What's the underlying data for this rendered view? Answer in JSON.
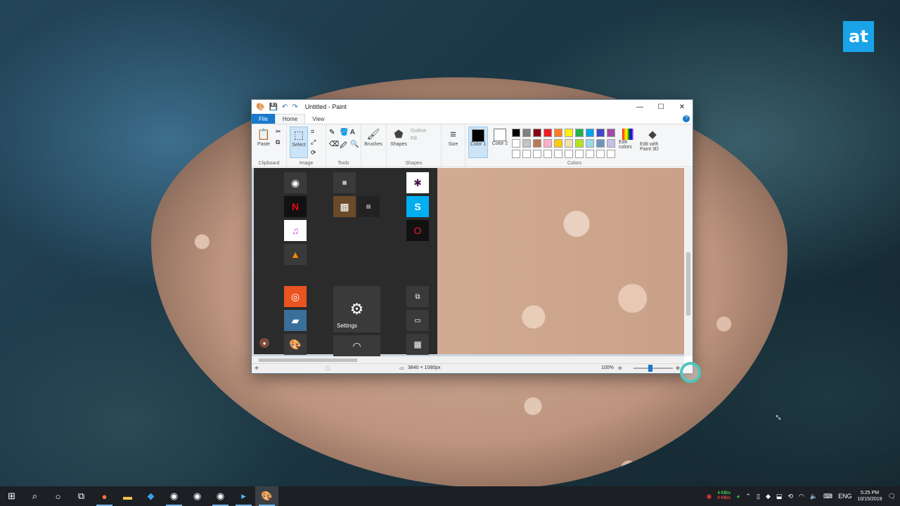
{
  "brand": {
    "logo_text": "at",
    "color": "#1aa3e8"
  },
  "window": {
    "title": "Untitled - Paint",
    "controls": {
      "minimize": "—",
      "maximize": "☐",
      "close": "✕"
    }
  },
  "tabs": [
    {
      "label": "File"
    },
    {
      "label": "Home"
    },
    {
      "label": "View"
    }
  ],
  "ribbon": {
    "clipboard": {
      "paste": "Paste",
      "group": "Clipboard"
    },
    "image": {
      "select": "Select",
      "group": "Image"
    },
    "tools": {
      "group": "Tools"
    },
    "brushes": {
      "label": "Brushes"
    },
    "shapes": {
      "label": "Shapes",
      "outline": "Outline",
      "fill": "Fill",
      "group": "Shapes"
    },
    "size": {
      "label": "Size"
    },
    "colors": {
      "color1": "Color 1",
      "color2": "Color 2",
      "edit_colors": "Edit colors",
      "edit_paint3d": "Edit with Paint 3D",
      "group": "Colors",
      "palette": [
        "#000000",
        "#7f7f7f",
        "#880015",
        "#ed1c24",
        "#ff7f27",
        "#fff200",
        "#22b14c",
        "#00a2e8",
        "#3f48cc",
        "#a349a4",
        "#ffffff",
        "#c3c3c3",
        "#b97a57",
        "#ffaec9",
        "#ffc90e",
        "#efe4b0",
        "#b5e61d",
        "#99d9ea",
        "#7092be",
        "#c8bfe7",
        "#ffffff",
        "#ffffff",
        "#ffffff",
        "#ffffff",
        "#ffffff",
        "#ffffff",
        "#ffffff",
        "#ffffff",
        "#ffffff",
        "#ffffff"
      ]
    }
  },
  "canvas": {
    "settings_tile_label": "Settings"
  },
  "statusbar": {
    "dimensions": "3840 × 1080px",
    "zoom": "100%"
  },
  "tray": {
    "net_up": "4 KB/s",
    "net_down": "0 KB/s",
    "language": "ENG",
    "time": "5:25 PM",
    "date": "10/15/2019"
  }
}
